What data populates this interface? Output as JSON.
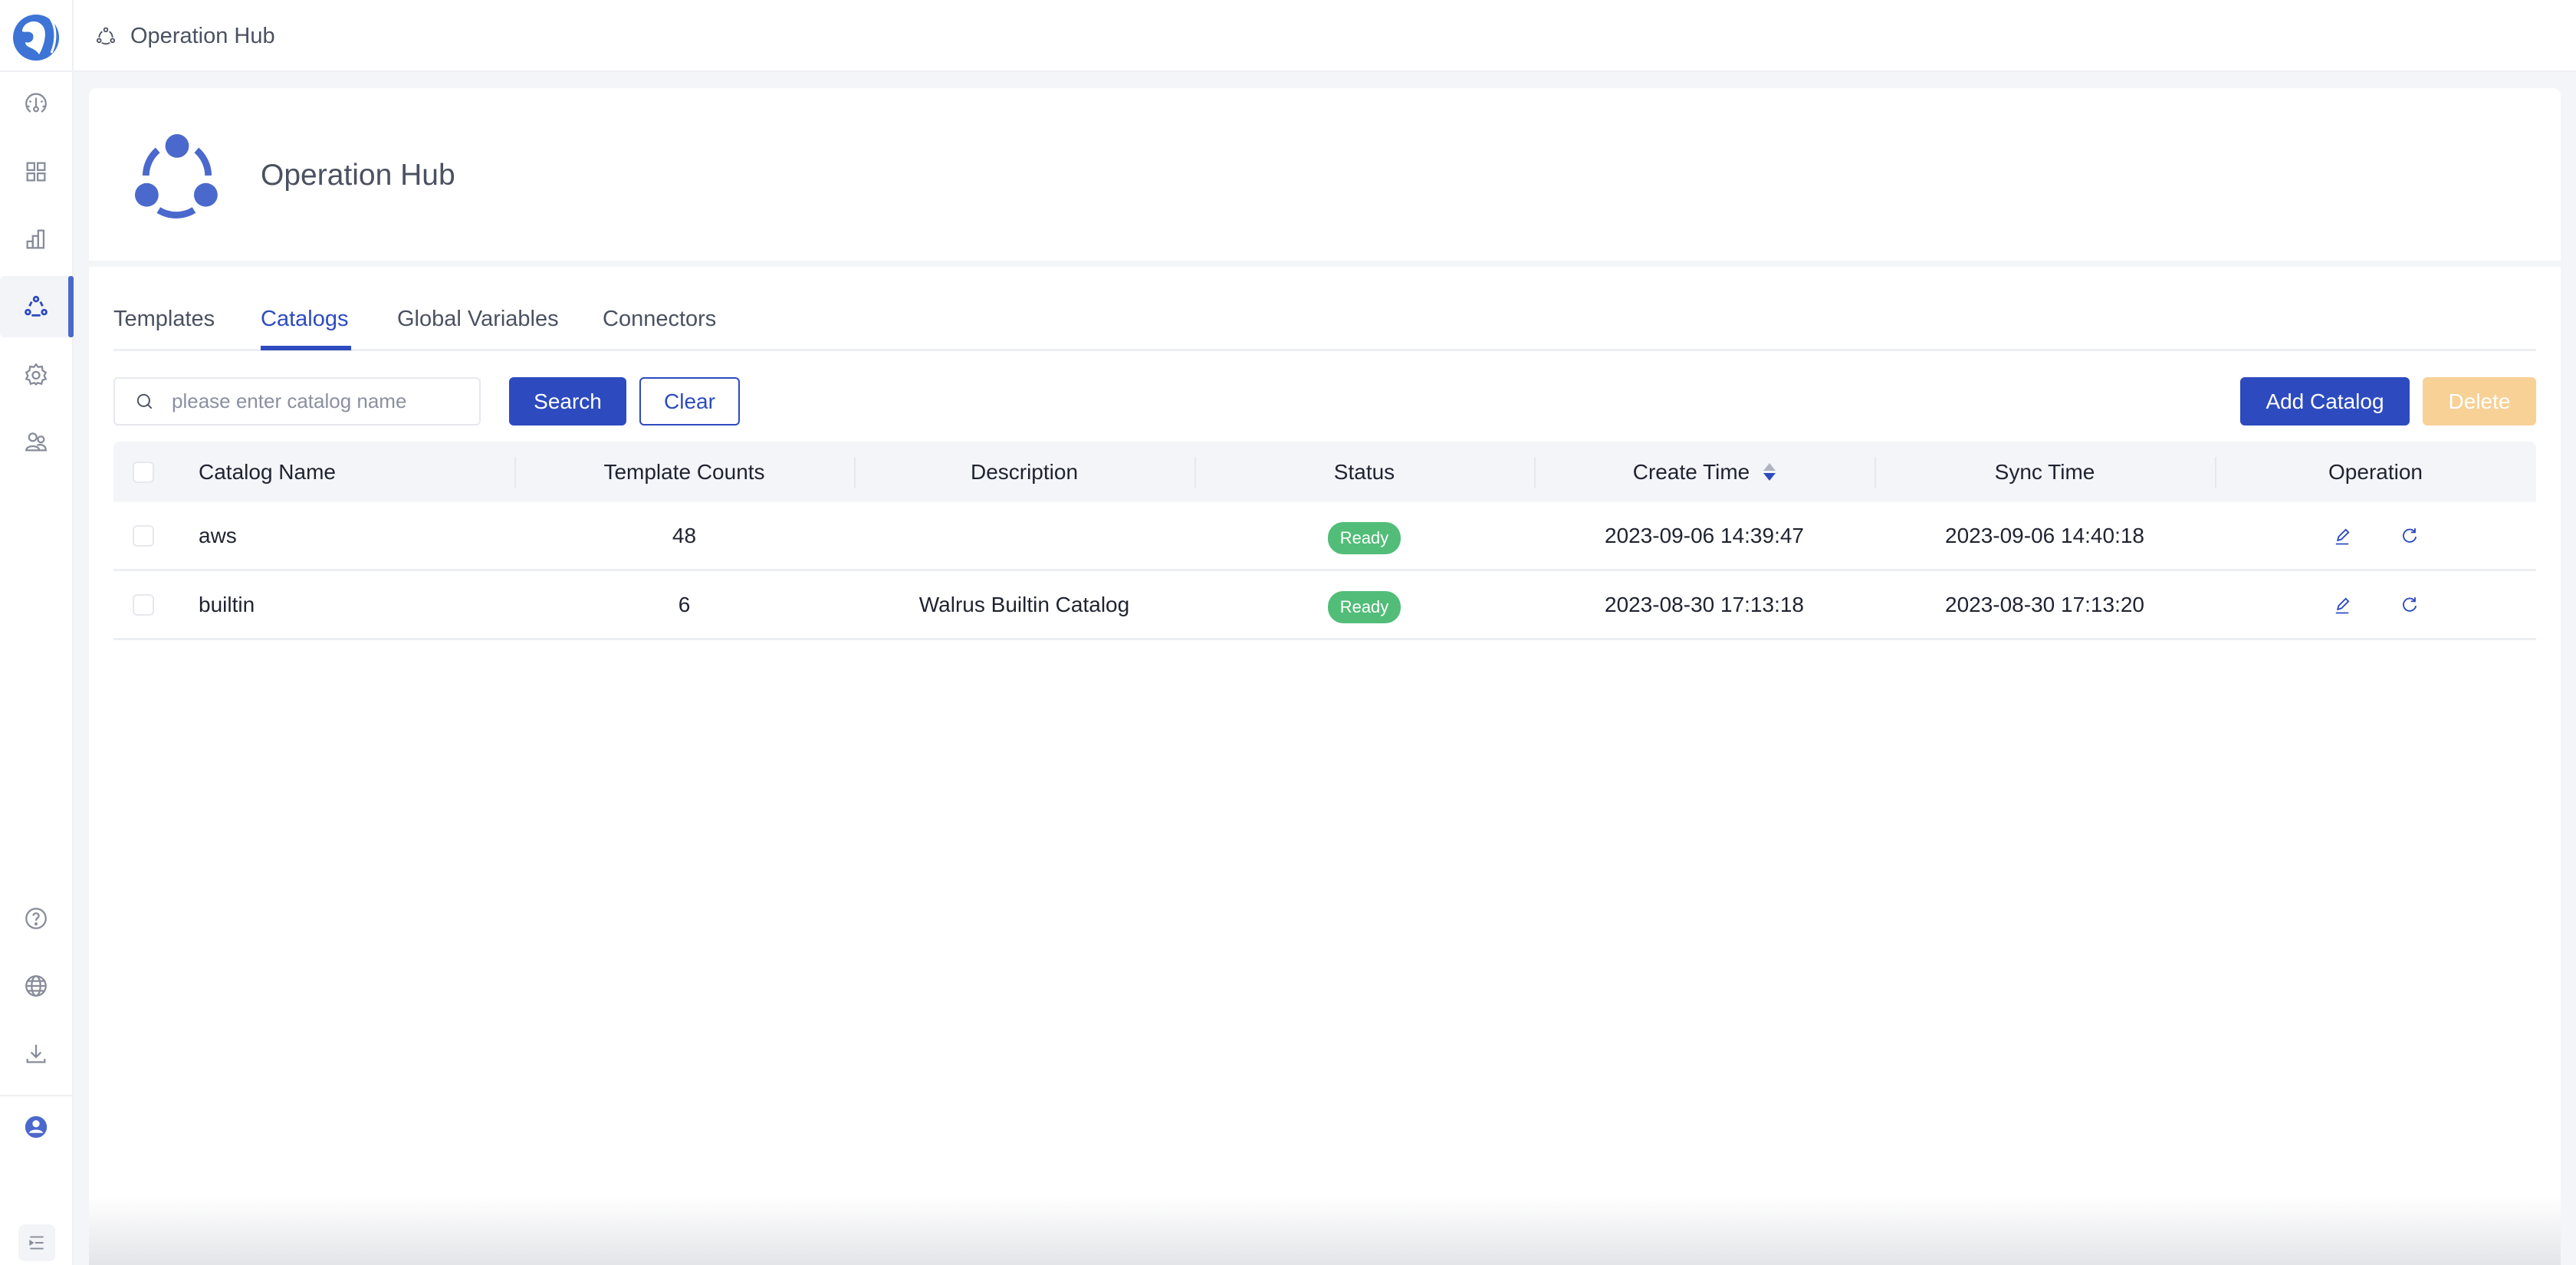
{
  "app": {
    "breadcrumb": "Operation Hub",
    "page_title": "Operation Hub",
    "accent_color": "#2d4bbf",
    "logo_icon": "walrus-logo-icon"
  },
  "sidebar": {
    "items": [
      {
        "name": "dashboard",
        "icon": "gauge-icon",
        "active": false
      },
      {
        "name": "applications",
        "icon": "grid-icon",
        "active": false
      },
      {
        "name": "cost",
        "icon": "bar-chart-icon",
        "active": false
      },
      {
        "name": "operation-hub",
        "icon": "hub-icon",
        "active": true
      },
      {
        "name": "settings",
        "icon": "gear-icon",
        "active": false
      },
      {
        "name": "users",
        "icon": "users-icon",
        "active": false
      }
    ],
    "bottom_items": [
      {
        "name": "help",
        "icon": "question-icon"
      },
      {
        "name": "language",
        "icon": "globe-icon"
      },
      {
        "name": "download",
        "icon": "download-icon"
      },
      {
        "name": "profile",
        "icon": "user-avatar-icon"
      },
      {
        "name": "collapse",
        "icon": "collapse-menu-icon"
      }
    ]
  },
  "tabs": [
    {
      "label": "Templates",
      "active": false
    },
    {
      "label": "Catalogs",
      "active": true
    },
    {
      "label": "Global Variables",
      "active": false
    },
    {
      "label": "Connectors",
      "active": false
    }
  ],
  "toolbar": {
    "search_placeholder": "please enter catalog name",
    "search_value": "",
    "search_label": "Search",
    "clear_label": "Clear",
    "add_label": "Add Catalog",
    "delete_label": "Delete"
  },
  "table": {
    "columns": [
      "Catalog Name",
      "Template Counts",
      "Description",
      "Status",
      "Create Time",
      "Sync Time",
      "Operation"
    ],
    "sort": {
      "column": "Create Time",
      "direction": "descending"
    },
    "rows": [
      {
        "name": "aws",
        "count": "48",
        "description": "",
        "status": "Ready",
        "create_time": "2023-09-06 14:39:47",
        "sync_time": "2023-09-06 14:40:18"
      },
      {
        "name": "builtin",
        "count": "6",
        "description": "Walrus Builtin Catalog",
        "status": "Ready",
        "create_time": "2023-08-30 17:13:18",
        "sync_time": "2023-08-30 17:13:20"
      }
    ],
    "status_color": "#52bd78"
  }
}
